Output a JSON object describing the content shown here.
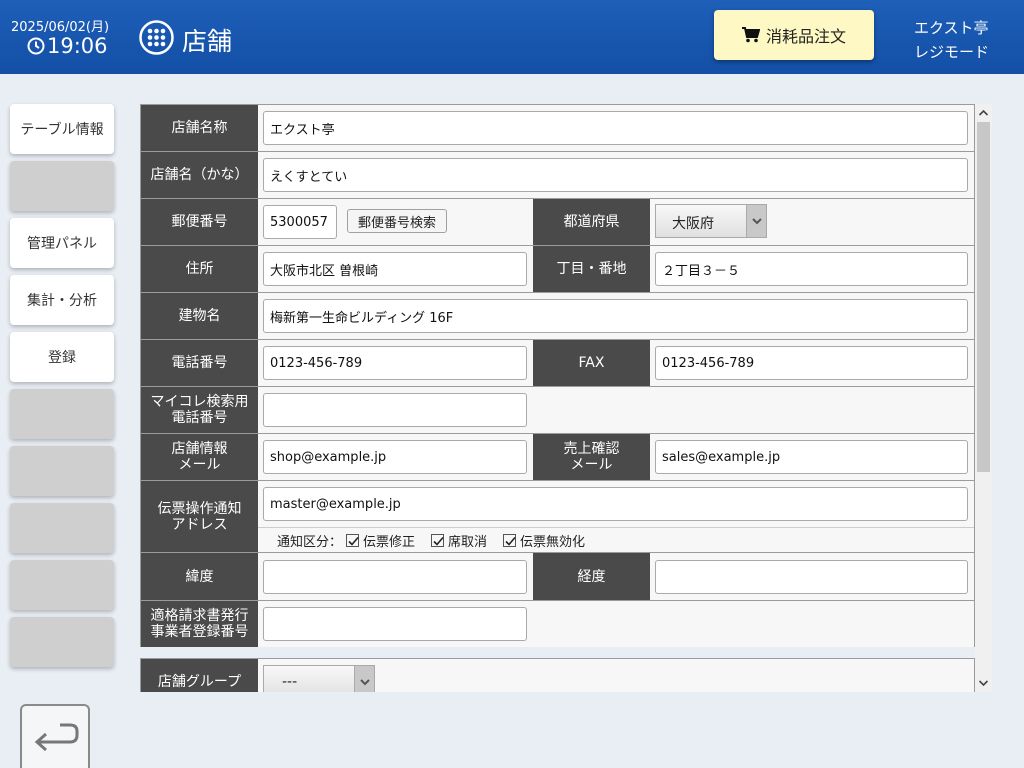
{
  "header": {
    "date": "2025/06/02(月)",
    "time": "19:06",
    "title": "店舗",
    "order_button": "消耗品注文",
    "store_name": "エクスト亭",
    "mode": "レジモード"
  },
  "sidebar": {
    "items": [
      {
        "label": "テーブル情報"
      },
      {
        "label": ""
      },
      {
        "label": "管理パネル"
      },
      {
        "label": "集計・分析"
      },
      {
        "label": "登録"
      },
      {
        "label": ""
      },
      {
        "label": ""
      },
      {
        "label": ""
      },
      {
        "label": ""
      },
      {
        "label": ""
      }
    ]
  },
  "form": {
    "store_name_label": "店舗名称",
    "store_name_value": "エクスト亭",
    "store_kana_label": "店舗名（かな）",
    "store_kana_value": "えくすとてい",
    "postal_label": "郵便番号",
    "postal_value": "5300057",
    "postal_search_button": "郵便番号検索",
    "prefecture_label": "都道府県",
    "prefecture_value": "大阪府",
    "address_label": "住所",
    "address_value": "大阪市北区 曽根崎",
    "block_label": "丁目・番地",
    "block_value": "２丁目３－５",
    "building_label": "建物名",
    "building_value": "梅新第一生命ビルディング 16F",
    "phone_label": "電話番号",
    "phone_value": "0123-456-789",
    "fax_label": "FAX",
    "fax_value": "0123-456-789",
    "mycolle_label_1": "マイコレ検索用",
    "mycolle_label_2": "電話番号",
    "mycolle_value": "",
    "shop_mail_label_1": "店舗情報",
    "shop_mail_label_2": "メール",
    "shop_mail_value": "shop@example.jp",
    "sales_mail_label_1": "売上確認",
    "sales_mail_label_2": "メール",
    "sales_mail_value": "sales@example.jp",
    "notify_label_1": "伝票操作通知",
    "notify_label_2": "アドレス",
    "notify_value": "master@example.jp",
    "notify_kind_label": "通知区分：",
    "notify_option_1": "伝票修正",
    "notify_option_2": "席取消",
    "notify_option_3": "伝票無効化",
    "latitude_label": "緯度",
    "latitude_value": "",
    "longitude_label": "経度",
    "longitude_value": "",
    "invoice_label_1": "適格請求書発行",
    "invoice_label_2": "事業者登録番号",
    "invoice_value": "",
    "group_label": "店舗グループ",
    "group_value": "---"
  }
}
